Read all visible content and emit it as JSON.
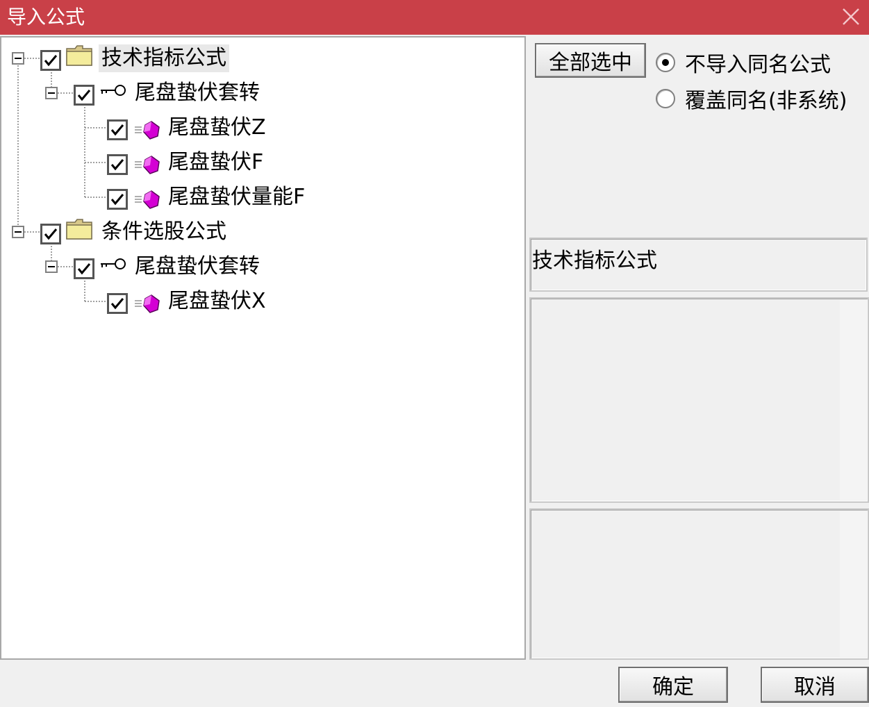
{
  "window": {
    "title": "导入公式",
    "close_icon": "close-icon"
  },
  "tree": [
    {
      "label": "技术指标公式",
      "icon": "folder-icon",
      "checked": true,
      "expanded": true,
      "selected": true,
      "children": [
        {
          "label": "尾盘蛰伏套转",
          "icon": "key-icon",
          "checked": true,
          "expanded": true,
          "children": [
            {
              "label": "尾盘蛰伏Z",
              "icon": "formula-gem-icon",
              "checked": true
            },
            {
              "label": "尾盘蛰伏F",
              "icon": "formula-gem-icon",
              "checked": true
            },
            {
              "label": "尾盘蛰伏量能F",
              "icon": "formula-gem-icon",
              "checked": true
            }
          ]
        }
      ]
    },
    {
      "label": "条件选股公式",
      "icon": "folder-icon",
      "checked": true,
      "expanded": true,
      "selected": false,
      "children": [
        {
          "label": "尾盘蛰伏套转",
          "icon": "key-icon",
          "checked": true,
          "expanded": true,
          "children": [
            {
              "label": "尾盘蛰伏X",
              "icon": "formula-gem-icon",
              "checked": true
            }
          ]
        }
      ]
    }
  ],
  "options": {
    "select_all_label": "全部选中",
    "radios": [
      {
        "label": "不导入同名公式",
        "selected": true
      },
      {
        "label": "覆盖同名(非系统)",
        "selected": false
      }
    ]
  },
  "info": {
    "category_text": "技术指标公式",
    "description_text": "",
    "detail_text": ""
  },
  "footer": {
    "ok_label": "确定",
    "cancel_label": "取消"
  },
  "colors": {
    "titlebar": "#c94048",
    "gem": "#d400d4",
    "folder": "#f0e68c"
  }
}
